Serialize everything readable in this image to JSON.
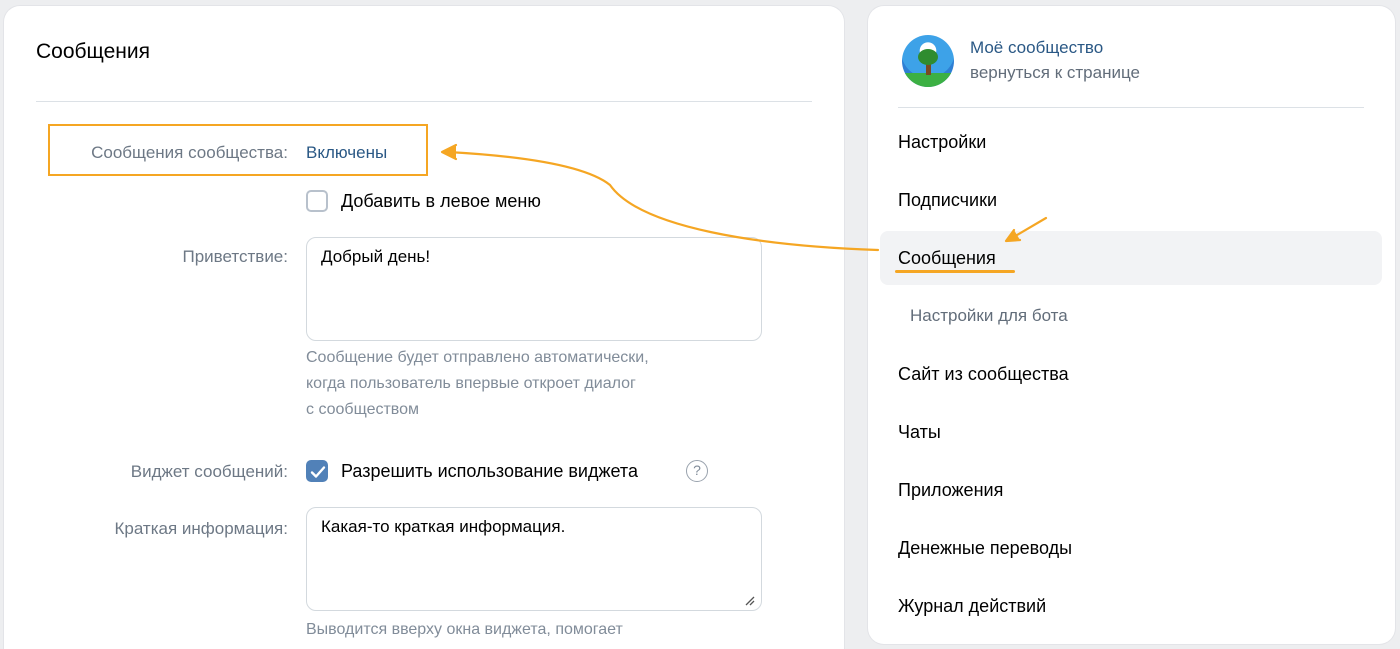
{
  "main": {
    "title": "Сообщения",
    "messages_label": "Сообщения сообщества:",
    "messages_value": "Включены",
    "left_menu_checkbox": {
      "label": "Добавить в левое меню",
      "checked": false
    },
    "greeting_label": "Приветствие:",
    "greeting_value": "Добрый день!",
    "greeting_hint_lines": [
      "Сообщение будет отправлено автоматически,",
      "когда пользователь впервые откроет диалог",
      "с сообществом"
    ],
    "widget_label": "Виджет сообщений:",
    "widget_checkbox": {
      "label": "Разрешить использование виджета",
      "checked": true
    },
    "help_glyph": "?",
    "short_info_label": "Краткая информация:",
    "short_info_value": "Какая-то краткая информация.",
    "short_info_hint": "Выводится вверху окна виджета, помогает"
  },
  "sidebar": {
    "community_name": "Моё сообщество",
    "back_link": "вернуться к странице",
    "items": [
      {
        "label": "Настройки"
      },
      {
        "label": "Подписчики"
      },
      {
        "label": "Сообщения",
        "active": true
      },
      {
        "label": "Настройки для бота",
        "sub": true
      },
      {
        "label": "Сайт из сообщества"
      },
      {
        "label": "Чаты"
      },
      {
        "label": "Приложения"
      },
      {
        "label": "Денежные переводы"
      },
      {
        "label": "Журнал действий"
      }
    ]
  },
  "colors": {
    "accent_link": "#2a5885",
    "annotation": "#f5a623",
    "checkbox_checked": "#5181b8"
  },
  "icons": [
    "checkmark-icon",
    "help-icon",
    "resize-handle-icon",
    "community-avatar",
    "annotation-arrow"
  ]
}
